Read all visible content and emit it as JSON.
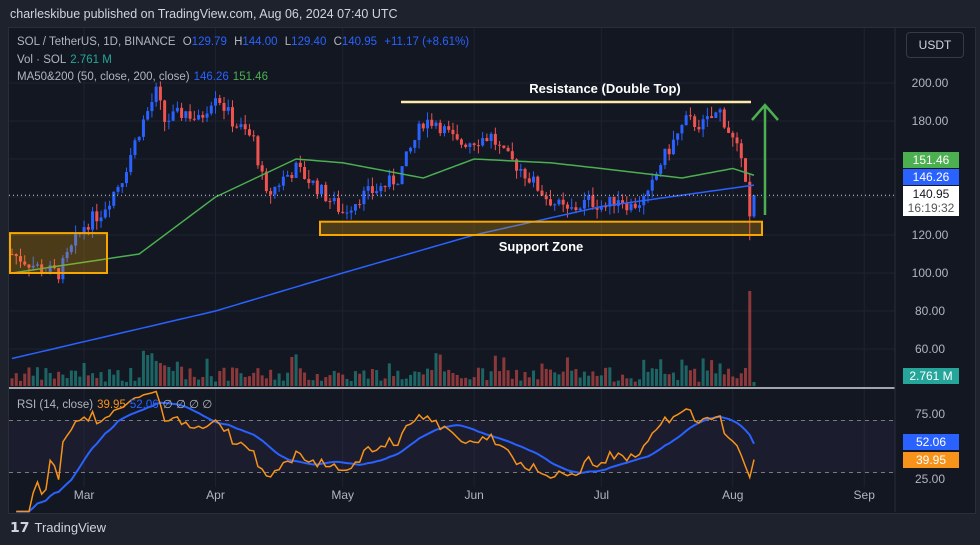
{
  "publisher_line": "charleskibue published on TradingView.com, Aug 06, 2024 07:40 UTC",
  "legend": {
    "symbol": "SOL / TetherUS, 1D, BINANCE",
    "o_label": "O",
    "o": "129.79",
    "h_label": "H",
    "h": "144.00",
    "l_label": "L",
    "l": "129.40",
    "c_label": "C",
    "c": "140.95",
    "change": "+11.17 (+8.61%)",
    "vol_label": "Vol · SOL",
    "vol": "2.761 M",
    "ma_label": "MA50&200 (50, close, 200, close)",
    "ma200": "146.26",
    "ma50": "151.46",
    "rsi_label": "RSI (14, close)",
    "rsi": "39.95",
    "rsi_ma": "52.06",
    "rsi_extra": "∅ ∅ ∅ ∅"
  },
  "currency_button": "USDT",
  "price_tags": {
    "ma50": "151.46",
    "ma200": "146.26",
    "last": "140.95",
    "countdown": "16:19:32",
    "volume": "2.761 M",
    "rsi_ma": "52.06",
    "rsi": "39.95"
  },
  "annotations": {
    "resistance": "Resistance (Double Top)",
    "support": "Support Zone"
  },
  "footer": "TradingView",
  "colors": {
    "up": "#2962ff",
    "down": "#ef5350",
    "ma50": "#4caf50",
    "ma200": "#2962ff",
    "rsi": "#f7931a",
    "rsi_ma": "#2962ff",
    "annotation": "#f7a600"
  },
  "chart_data": {
    "type": "candlestick",
    "title": "SOL / TetherUS, 1D, BINANCE",
    "y_ticks": [
      "200.00",
      "180.00",
      "120.00",
      "100.00",
      "80.00",
      "60.00"
    ],
    "y_tick_values": [
      200,
      180,
      120,
      100,
      80,
      60
    ],
    "rsi_ticks": [
      "75.00",
      "25.00"
    ],
    "rsi_tick_values": [
      75,
      25
    ],
    "x_ticks": [
      "Mar",
      "Apr",
      "May",
      "Jun",
      "Jul",
      "Aug",
      "Sep"
    ],
    "x_tick_days": [
      17,
      48,
      78,
      109,
      139,
      170,
      201
    ],
    "start_date": "2024-02-13",
    "close_keypoints": [
      [
        0,
        110
      ],
      [
        7,
        102
      ],
      [
        11,
        100
      ],
      [
        17,
        125
      ],
      [
        21,
        132
      ],
      [
        26,
        150
      ],
      [
        30,
        175
      ],
      [
        34,
        195
      ],
      [
        36,
        180
      ],
      [
        41,
        185
      ],
      [
        44,
        180
      ],
      [
        48,
        195
      ],
      [
        52,
        180
      ],
      [
        57,
        170
      ],
      [
        60,
        140
      ],
      [
        64,
        150
      ],
      [
        67,
        155
      ],
      [
        72,
        145
      ],
      [
        78,
        132
      ],
      [
        82,
        140
      ],
      [
        87,
        145
      ],
      [
        91,
        150
      ],
      [
        97,
        180
      ],
      [
        100,
        180
      ],
      [
        105,
        168
      ],
      [
        113,
        172
      ],
      [
        116,
        162
      ],
      [
        120,
        155
      ],
      [
        126,
        140
      ],
      [
        131,
        132
      ],
      [
        136,
        138
      ],
      [
        140,
        135
      ],
      [
        143,
        140
      ],
      [
        146,
        135
      ],
      [
        150,
        140
      ],
      [
        153,
        158
      ],
      [
        159,
        180
      ],
      [
        163,
        178
      ],
      [
        167,
        185
      ],
      [
        169,
        175
      ],
      [
        171,
        165
      ],
      [
        173,
        148
      ],
      [
        174,
        129.79
      ],
      [
        175,
        140.95
      ]
    ],
    "ma50_keypoints": [
      [
        0,
        100
      ],
      [
        30,
        110
      ],
      [
        48,
        140
      ],
      [
        67,
        160
      ],
      [
        78,
        158
      ],
      [
        97,
        150
      ],
      [
        109,
        160
      ],
      [
        127,
        158
      ],
      [
        139,
        155
      ],
      [
        158,
        150
      ],
      [
        170,
        155
      ],
      [
        175,
        151.46
      ]
    ],
    "ma200_keypoints": [
      [
        0,
        55
      ],
      [
        48,
        80
      ],
      [
        78,
        100
      ],
      [
        109,
        120
      ],
      [
        139,
        135
      ],
      [
        175,
        146.26
      ]
    ],
    "resistance_level": 190,
    "support_zone": [
      120,
      127
    ],
    "left_box": [
      100,
      121
    ],
    "last_volume_millions": 2.761
  }
}
